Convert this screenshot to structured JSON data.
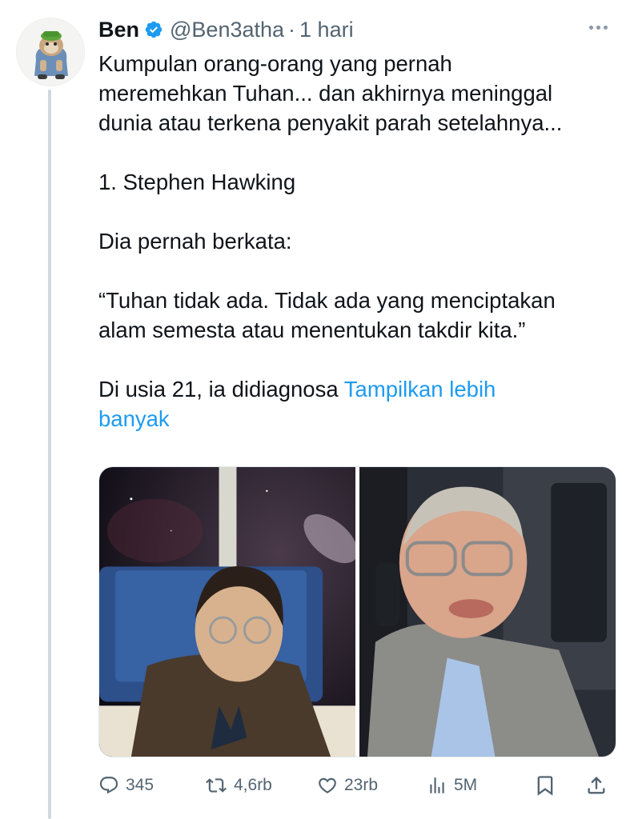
{
  "tweet": {
    "author_name": "Ben",
    "handle": "@Ben3atha",
    "separator": "·",
    "time": "1 hari",
    "text_lines": [
      "Kumpulan orang-orang yang pernah",
      "meremehkan Tuhan... dan akhirnya meninggal",
      "dunia atau terkena penyakit parah setelahnya..."
    ],
    "item_heading": "1. Stephen Hawking",
    "said_line": "Dia pernah berkata:",
    "quote_lines": [
      "“Tuhan tidak ada. Tidak ada yang menciptakan",
      "alam semesta atau menentukan takdir kita.”"
    ],
    "truncated_text": "Di usia 21, ia didiagnosa ",
    "show_more_line1": "Tampilkan lebih",
    "show_more_line2": "banyak"
  },
  "media": [
    {
      "description": "Young Stephen Hawking in a blue chair, starry background"
    },
    {
      "description": "Older Stephen Hawking in a wheelchair wearing glasses"
    }
  ],
  "actions": {
    "reply_count": "345",
    "retweet_count": "4,6rb",
    "like_count": "23rb",
    "view_count": "5M"
  },
  "icons": {
    "reply": "speech-bubble-icon",
    "retweet": "retweet-arrows-icon",
    "like": "heart-icon",
    "views": "bar-chart-icon",
    "bookmark": "bookmark-icon",
    "share": "share-upload-icon",
    "verified": "verified-badge-icon",
    "more": "more-dots-icon"
  },
  "colors": {
    "link": "#1d9bf0",
    "secondary": "#536471",
    "thread_line": "#cfd9de",
    "verified": "#1d9bf0"
  }
}
